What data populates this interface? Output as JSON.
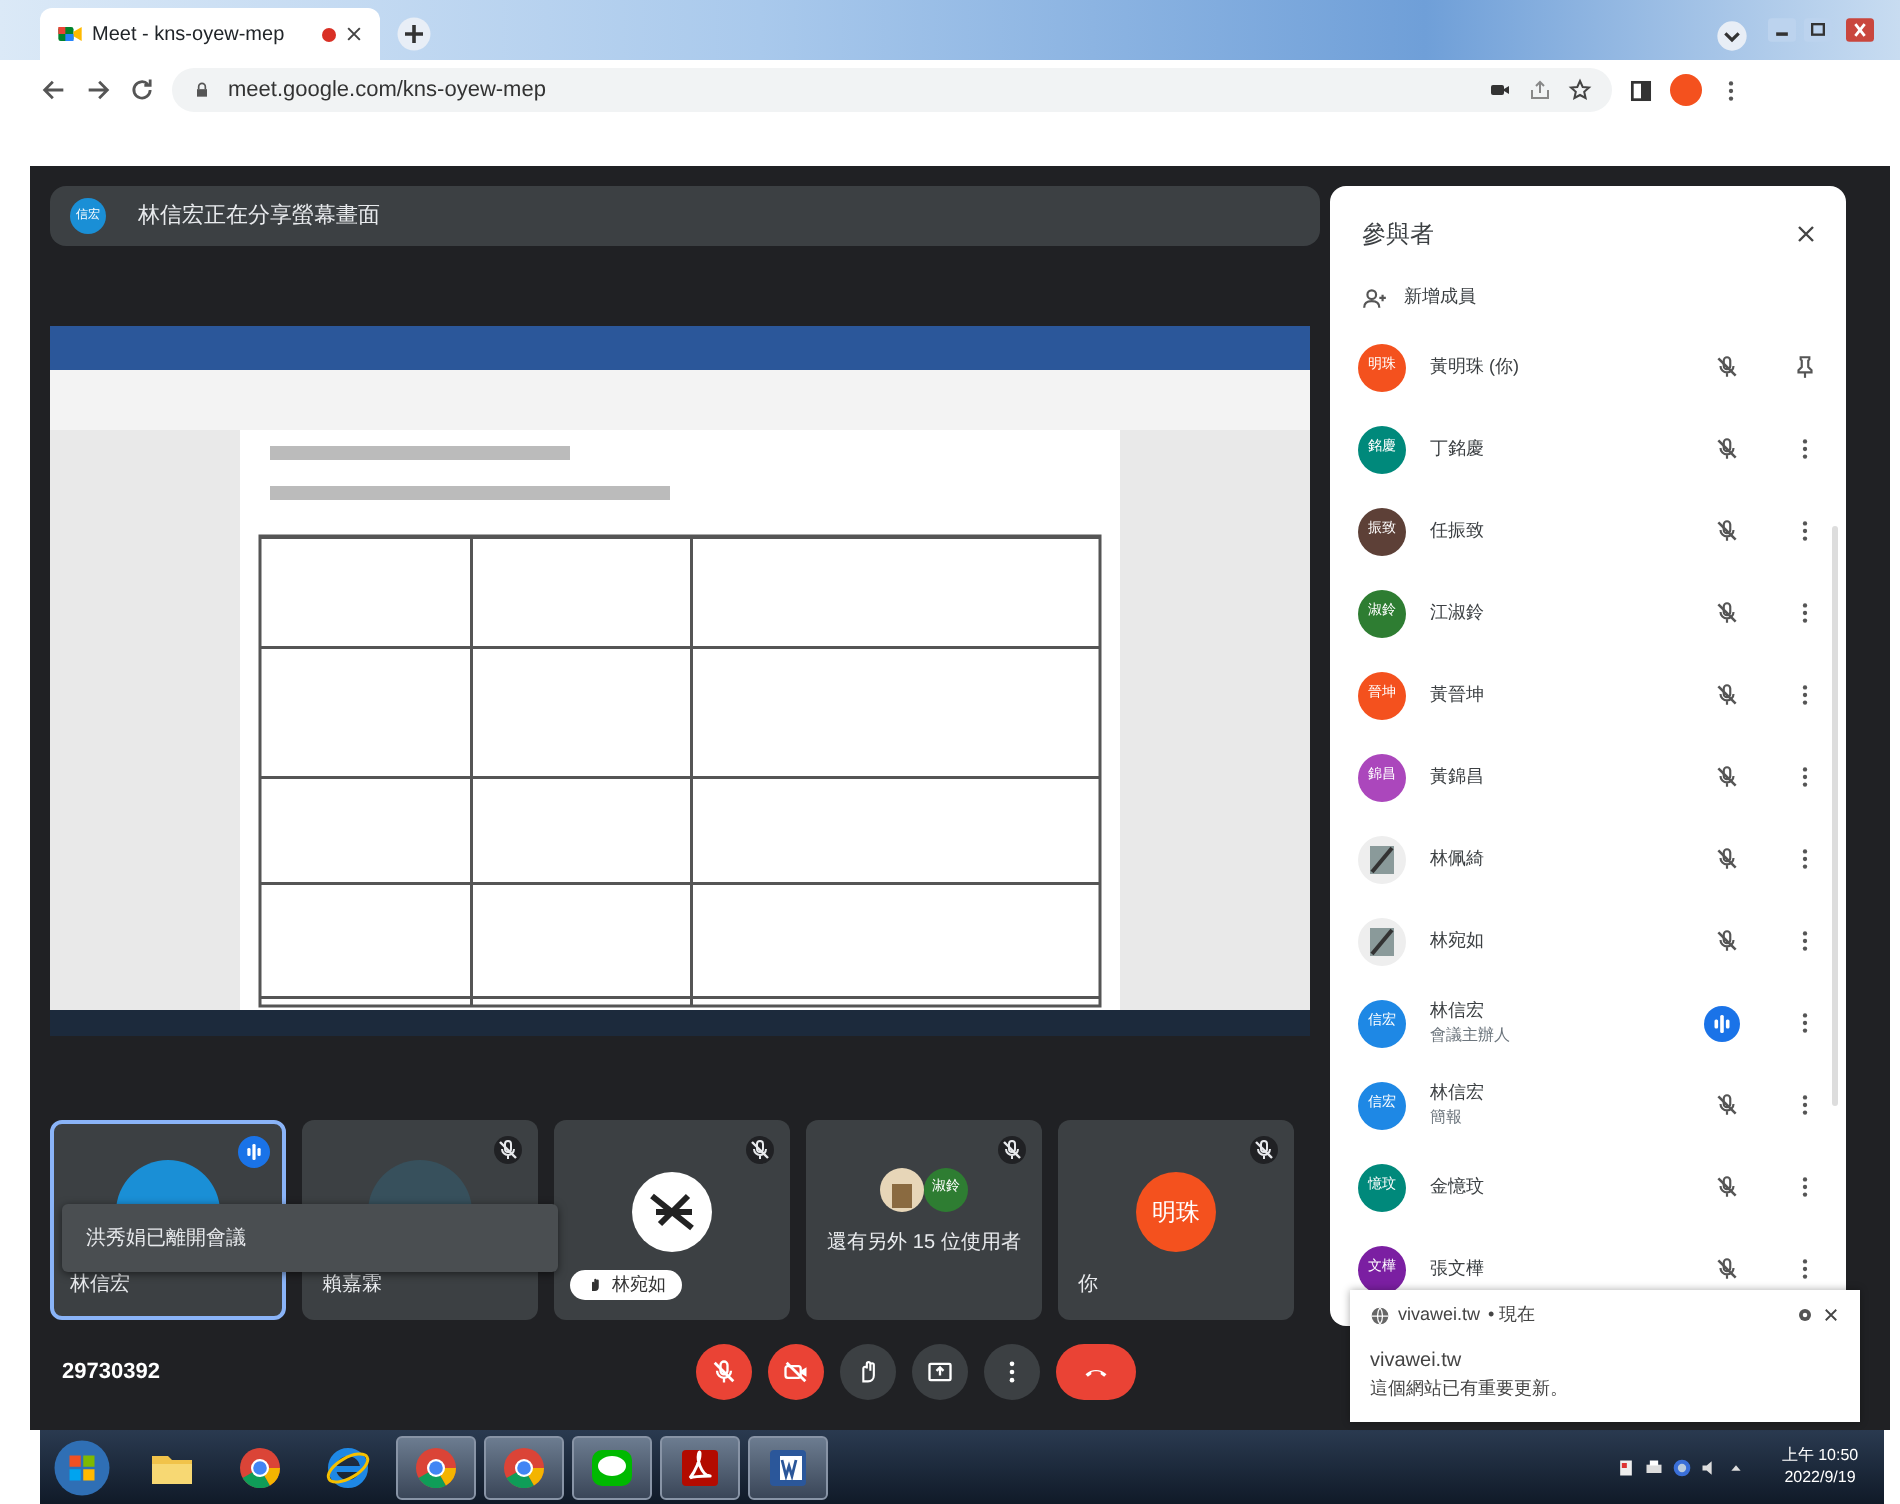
{
  "browser": {
    "tab_title": "Meet - kns-oyew-mep",
    "recording": true,
    "url": "meet.google.com/kns-oyew-mep"
  },
  "presenter_banner": {
    "avatar": "信宏",
    "text": "林信宏正在分享螢幕畫面"
  },
  "tiles": [
    {
      "kind": "avatar",
      "name": "林信宏",
      "color": "#1a8fd6",
      "speaking": true
    },
    {
      "kind": "avatar",
      "name": "賴嘉霖",
      "color": "#37505c",
      "speaking": false
    },
    {
      "kind": "picture",
      "name": "林宛如",
      "speaking": false
    },
    {
      "kind": "group",
      "name": "還有另外 15 位使用者",
      "badge": "淑鈴",
      "color": "#2e7d32",
      "speaking": false
    },
    {
      "kind": "initials",
      "name": "你",
      "initials": "明珠",
      "color": "#f4511e",
      "speaking": false
    }
  ],
  "toast": "洪秀娟已離開會議",
  "meeting_code": "29730392",
  "controls": [
    {
      "kind": "mic",
      "off": true
    },
    {
      "kind": "camera",
      "off": true
    },
    {
      "kind": "hand",
      "off": false
    },
    {
      "kind": "present",
      "off": false
    },
    {
      "kind": "more",
      "off": false
    },
    {
      "kind": "leave",
      "off": true
    }
  ],
  "panel": {
    "title": "參與者",
    "add_label": "新增成員",
    "participants": [
      {
        "kind": "initials",
        "initials": "明珠",
        "color": "#f4511e",
        "name": "黃明珠 (你)",
        "speaking": false,
        "has_menu": false
      },
      {
        "kind": "initials",
        "initials": "銘慶",
        "color": "#00897b",
        "name": "丁銘慶",
        "speaking": false,
        "has_menu": true
      },
      {
        "kind": "initials",
        "initials": "振致",
        "color": "#5d4037",
        "name": "任振致",
        "speaking": false,
        "has_menu": true
      },
      {
        "kind": "initials",
        "initials": "淑鈴",
        "color": "#2e7d32",
        "name": "江淑鈴",
        "speaking": false,
        "has_menu": true
      },
      {
        "kind": "initials",
        "initials": "晉坤",
        "color": "#f4511e",
        "name": "黃晉坤",
        "speaking": false,
        "has_menu": true
      },
      {
        "kind": "initials",
        "initials": "錦昌",
        "color": "#ab47bc",
        "name": "黃錦昌",
        "speaking": false,
        "has_menu": true
      },
      {
        "kind": "picture",
        "name": "林佩綺",
        "speaking": false,
        "has_menu": true
      },
      {
        "kind": "picture",
        "name": "林宛如",
        "speaking": false,
        "has_menu": true
      },
      {
        "kind": "initials",
        "initials": "信宏",
        "color": "#1e88e5",
        "name": "林信宏",
        "role": "會議主辦人",
        "speaking": true,
        "has_menu": true
      },
      {
        "kind": "initials",
        "initials": "信宏",
        "color": "#1e88e5",
        "name": "林信宏",
        "role": "簡報",
        "speaking": false,
        "has_menu": true
      },
      {
        "kind": "initials",
        "initials": "憶玟",
        "color": "#00897b",
        "name": "金憶玟",
        "speaking": false,
        "has_menu": true
      },
      {
        "kind": "initials",
        "initials": "文樺",
        "color": "#7b1fa2",
        "name": "張文樺",
        "speaking": false,
        "has_menu": true
      }
    ]
  },
  "notification": {
    "site": "vivawei.tw",
    "time": "• 現在",
    "title": "vivawei.tw",
    "body": "這個網站已有重要更新。"
  },
  "taskbar": {
    "apps": [
      {
        "kind": "folder",
        "active": false
      },
      {
        "kind": "chrome",
        "active": false
      },
      {
        "kind": "ie",
        "active": false
      },
      {
        "kind": "chrome",
        "active": true
      },
      {
        "kind": "chrome",
        "active": true
      },
      {
        "kind": "line",
        "active": true
      },
      {
        "kind": "pdf",
        "active": true
      },
      {
        "kind": "word",
        "active": true
      }
    ],
    "time": "上午 10:50",
    "date": "2022/9/19"
  }
}
